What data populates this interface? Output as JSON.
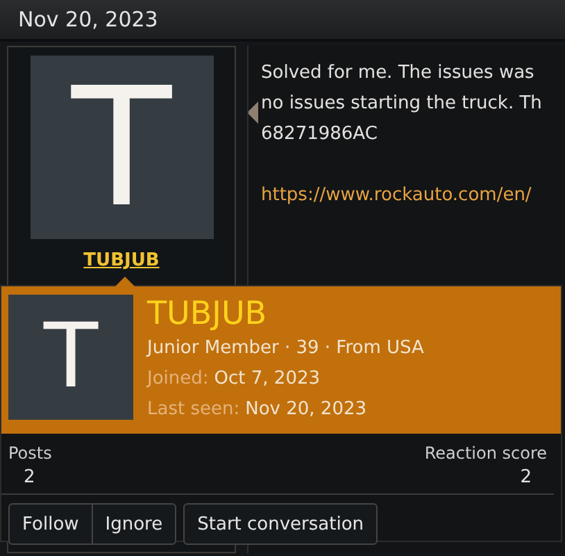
{
  "date": "Nov 20, 2023",
  "post": {
    "avatar_letter": "T",
    "username": "TUBJUB",
    "message_lines": [
      "Solved for me. The issues was",
      "no issues starting the truck. Th",
      "68271986AC"
    ],
    "link": "https://www.rockauto.com/en/"
  },
  "profile_card": {
    "avatar_letter": "T",
    "username": "TUBJUB",
    "info": "Junior Member · 39 · From USA",
    "joined_label": "Joined:",
    "joined": "Oct 7, 2023",
    "last_seen_label": "Last seen:",
    "last_seen": "Nov 20, 2023",
    "stats": [
      {
        "label": "Posts",
        "value": "2"
      },
      {
        "label": "Reaction score",
        "value": "2"
      }
    ],
    "buttons": [
      {
        "label": "Follow",
        "kind": "grouped"
      },
      {
        "label": "Ignore",
        "kind": "grouped"
      },
      {
        "label": "Start conversation",
        "kind": "single"
      }
    ]
  }
}
